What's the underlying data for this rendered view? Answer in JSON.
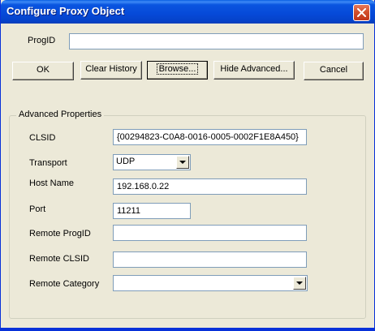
{
  "window": {
    "title": "Configure Proxy Object"
  },
  "progid": {
    "label": "ProgID",
    "value": ""
  },
  "buttons": {
    "ok": "OK",
    "clear_history": "Clear History",
    "browse": "Browse...",
    "hide_advanced": "Hide Advanced...",
    "cancel": "Cancel"
  },
  "advanced": {
    "title": "Advanced Properties",
    "clsid": {
      "label": "CLSID",
      "value": "{00294823-C0A8-0016-0005-0002F1E8A450}"
    },
    "transport": {
      "label": "Transport",
      "value": "UDP"
    },
    "host_name": {
      "label": "Host Name",
      "value": "192.168.0.22"
    },
    "port": {
      "label": "Port",
      "value": "11211"
    },
    "remote_progid": {
      "label": "Remote ProgID",
      "value": ""
    },
    "remote_clsid": {
      "label": "Remote CLSID",
      "value": ""
    },
    "remote_category": {
      "label": "Remote Category",
      "value": ""
    }
  },
  "icons": {
    "close": "close-icon",
    "dropdown": "chevron-down-icon"
  },
  "colors": {
    "titlebar": "#0a55e0",
    "close_button": "#d3502d",
    "dialog_face": "#ece9d8"
  }
}
